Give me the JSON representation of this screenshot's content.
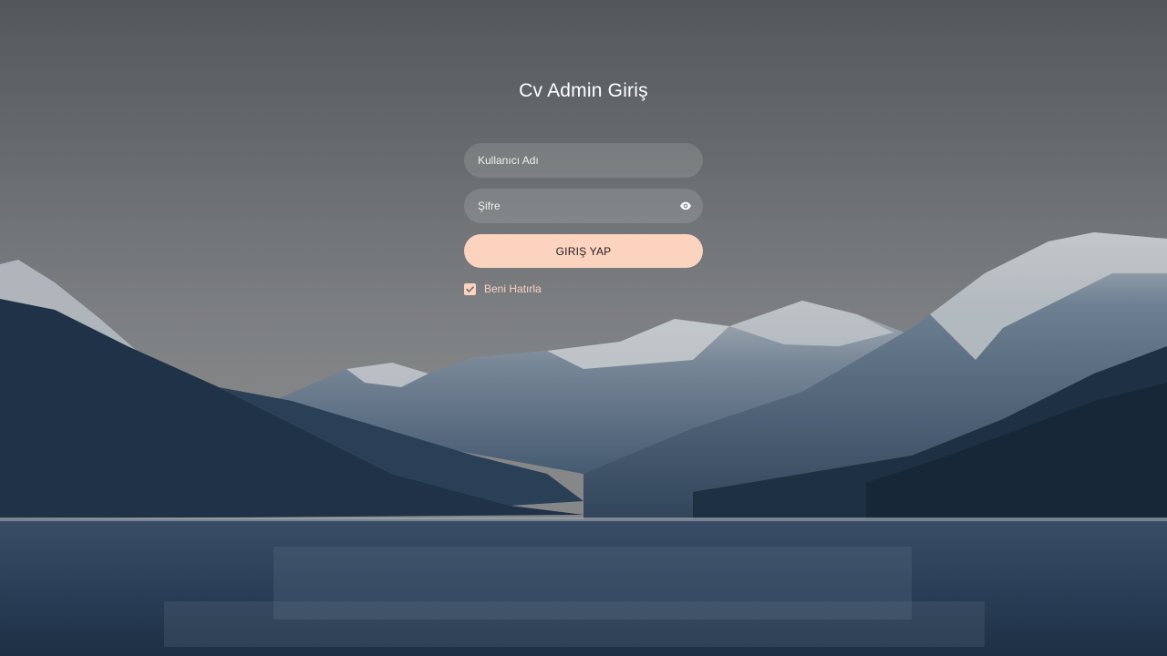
{
  "page": {
    "title": "Cv Admin Giriş"
  },
  "form": {
    "username_placeholder": "Kullanıcı Adı",
    "username_value": "",
    "password_placeholder": "Şifre",
    "password_value": "",
    "submit_label": "GIRIŞ YAP",
    "remember_label": "Beni Hatırla",
    "remember_checked": true
  },
  "icons": {
    "password_toggle": "eye-icon",
    "checkbox": "checkmark-icon"
  },
  "colors": {
    "accent": "#fcd3bf",
    "button_text": "#222222",
    "title_text": "#ffffff"
  }
}
